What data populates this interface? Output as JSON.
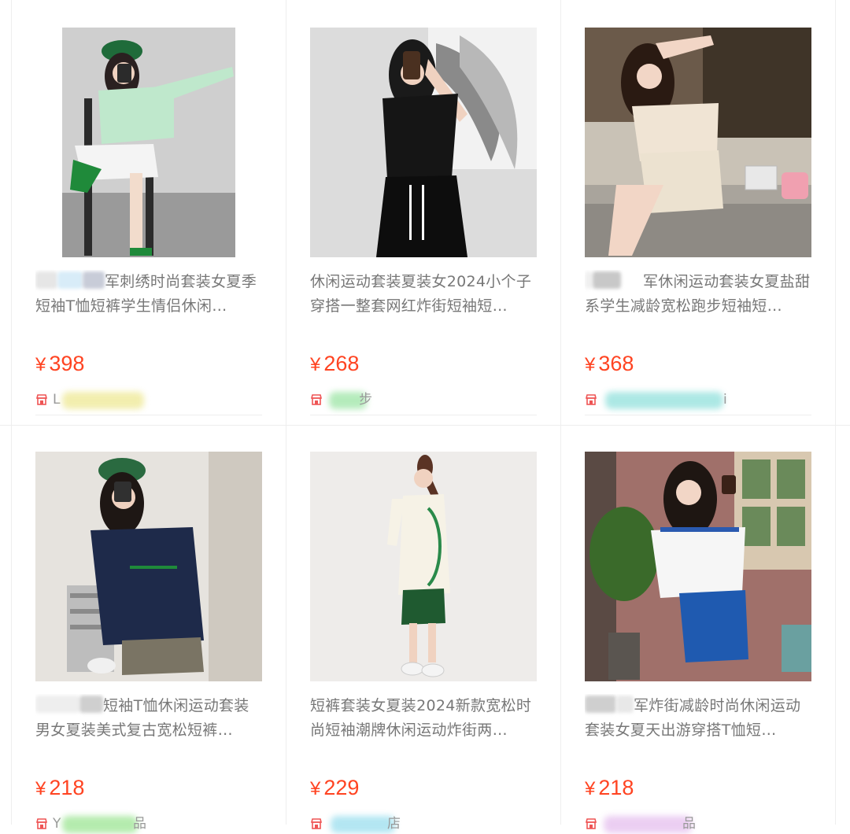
{
  "currency_symbol": "¥",
  "products": [
    {
      "title": "军刺绣时尚套装女夏季短袖T恤短裤学生情侣休闲…",
      "price": "398",
      "shop": "L",
      "shop_blur_color": "#f0eba0",
      "title_blur_colors": [
        "#e6e6e6",
        "#d8ecf8",
        "#c8ccd8"
      ]
    },
    {
      "title": "休闲运动套装夏装女2024小个子穿搭一整套网红炸街短袖短…",
      "price": "268",
      "shop": "步",
      "shop_blur_color": "#a8e8b0",
      "title_blur_colors": []
    },
    {
      "title": "军休闲运动套装女夏盐甜系学生减龄宽松跑步短袖短…",
      "price": "368",
      "shop": "i",
      "shop_blur_color": "#9ee4e0",
      "title_blur_colors": [
        "#f0f0f0",
        "#c8c8c8"
      ]
    },
    {
      "title": "短袖T恤休闲运动套装男女夏装美式复古宽松短裤…",
      "price": "218",
      "shop": "Y",
      "shop_suffix": "品",
      "shop_blur_color": "#a8e8a0",
      "title_blur_colors": [
        "#eeeeee",
        "#cfcfcf"
      ]
    },
    {
      "title": "短裤套装女夏装2024新款宽松时尚短袖潮牌休闲运动炸街两…",
      "price": "229",
      "shop": "",
      "shop_suffix": "店",
      "shop_blur_color": "#a6e2f0",
      "title_blur_colors": []
    },
    {
      "title": "军炸街减龄时尚休闲运动套装女夏天出游穿搭T恤短…",
      "price": "218",
      "shop": "",
      "shop_suffix": "品",
      "shop_blur_color": "#e8c6f0",
      "title_blur_colors": [
        "#cfcfcf",
        "#e8e8e8"
      ]
    }
  ],
  "icons": {
    "shop": "shop-icon"
  },
  "colors": {
    "price": "#ff4422",
    "title": "#777777",
    "shop_icon": "#ee5555"
  }
}
